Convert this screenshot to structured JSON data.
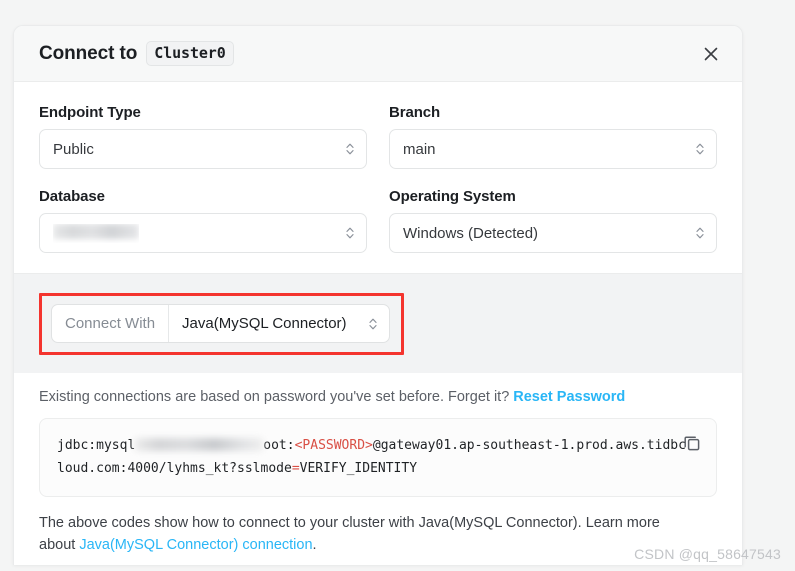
{
  "header": {
    "title": "Connect to",
    "cluster_name": "Cluster0",
    "close_icon": "close-icon"
  },
  "fields": [
    {
      "label": "Endpoint Type",
      "value": "Public",
      "redacted": false
    },
    {
      "label": "Branch",
      "value": "main",
      "redacted": false
    },
    {
      "label": "Database",
      "value": "",
      "redacted": true
    },
    {
      "label": "Operating System",
      "value": "Windows (Detected)",
      "redacted": false
    }
  ],
  "connect_with": {
    "label": "Connect With",
    "value": "Java(MySQL Connector)",
    "highlight_color": "#f4342e"
  },
  "password_note": {
    "text": "Existing connections are based on password you've set before. Forget it?",
    "link": "Reset Password"
  },
  "code": {
    "line1_prefix": "jdbc:mysql",
    "line1_mid": "oot:",
    "line1_token": "<PASSWORD>",
    "line1_suffix": "@gateway01.ap-southeast-1.prod.aws.tidbc",
    "line2_prefix": "loud.com:4000/lyhms_kt?sslmode",
    "line2_eq": "=",
    "line2_suffix": "VERIFY_IDENTITY",
    "copy_icon": "copy-icon"
  },
  "footer": {
    "text_before": "The above codes show how to connect to your cluster with Java(MySQL Connector). Learn more about ",
    "link": "Java(MySQL Connector) connection",
    "text_after": "."
  },
  "watermark": "CSDN @qq_58647543"
}
